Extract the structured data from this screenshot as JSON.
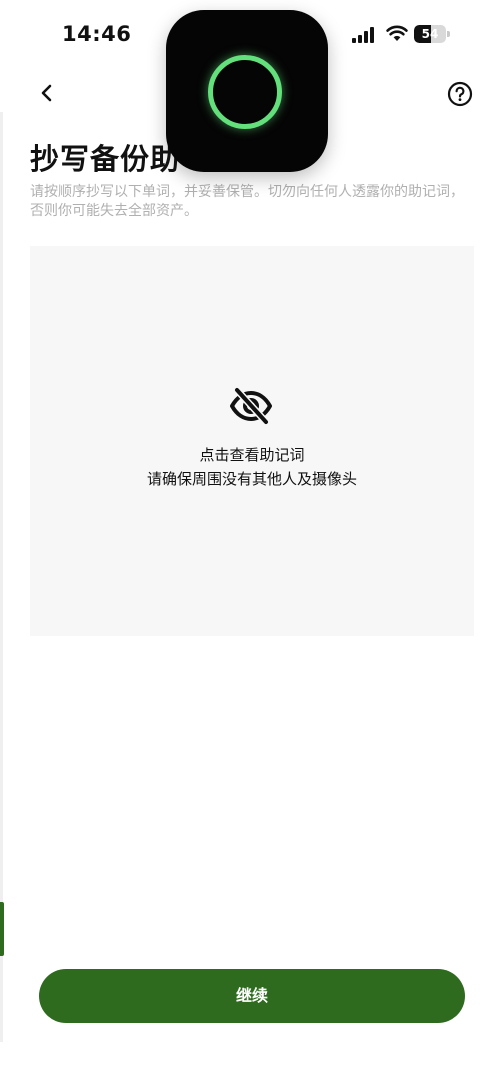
{
  "status_bar": {
    "time": "14:46",
    "battery_level": "54",
    "battery_fraction": 0.54
  },
  "overlay": {
    "icon": "green-ring-app-icon",
    "ring_color": "#63e07b"
  },
  "nav": {
    "back_icon": "chevron-left-icon",
    "help_icon": "question-circle-icon"
  },
  "page": {
    "title": "抄写备份助",
    "subtitle": "请按顺序抄写以下单词，并妥善保管。切勿向任何人透露你的助记词，否则你可能失去全部资产。"
  },
  "reveal": {
    "icon": "eye-off-icon",
    "title": "点击查看助记词",
    "hint": "请确保周围没有其他人及摄像头"
  },
  "actions": {
    "continue_label": "继续"
  },
  "colors": {
    "accent": "#2e6b1f",
    "panel_bg": "#f7f7f7",
    "subtitle_text": "#b0b0b0"
  }
}
